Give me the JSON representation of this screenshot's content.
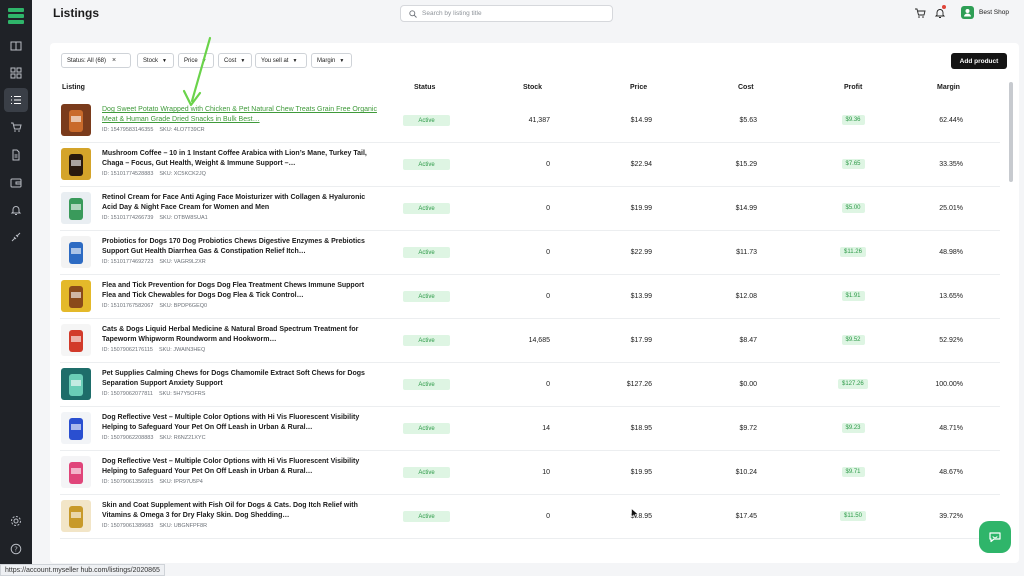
{
  "header": {
    "title": "Listings",
    "search_placeholder": "Search by listing title",
    "shop_name": "Best Shop"
  },
  "sidebar": {
    "items": [
      {
        "icon": "book-icon"
      },
      {
        "icon": "dashboard-icon"
      },
      {
        "icon": "list-icon",
        "active": true
      },
      {
        "icon": "cart-icon"
      },
      {
        "icon": "document-icon"
      },
      {
        "icon": "wallet-icon"
      },
      {
        "icon": "bell-icon"
      },
      {
        "icon": "plug-icon"
      },
      {
        "icon": "settings-icon"
      },
      {
        "icon": "help-icon"
      }
    ]
  },
  "filters": {
    "status": "Status: All (68)",
    "stock": "Stock",
    "price": "Price",
    "cost": "Cost",
    "you_sell_at": "You sell at",
    "margin": "Margin"
  },
  "actions": {
    "add_product": "Add product"
  },
  "table": {
    "headers": {
      "listing": "Listing",
      "status": "Status",
      "stock": "Stock",
      "price": "Price",
      "cost": "Cost",
      "profit": "Profit",
      "margin": "Margin"
    },
    "rows": [
      {
        "title": "Dog Sweet Potato Wrapped with Chicken & Pet Natural Chew Treats Grain Free Organic Meat & Human Grade Dried Snacks in Bulk Best…",
        "id": "ID: 15479583146355",
        "sku": "SKU: 4LO7T39CR",
        "status": "Active",
        "stock": "41,387",
        "price": "$14.99",
        "cost": "$5.63",
        "profit": "$9.36",
        "margin": "62.44%",
        "link": true
      },
      {
        "title": "Mushroom Coffee – 10 in 1 Instant Coffee Arabica with Lion’s Mane, Turkey Tail, Chaga – Focus, Gut Health, Weight & Immune Support –…",
        "id": "ID: 15101774528883",
        "sku": "SKU: XC5KCK2JQ",
        "status": "Active",
        "stock": "0",
        "price": "$22.94",
        "cost": "$15.29",
        "profit": "$7.65",
        "margin": "33.35%"
      },
      {
        "title": "Retinol Cream for Face Anti Aging Face Moisturizer with Collagen & Hyaluronic Acid Day & Night Face Cream for Women and Men",
        "id": "ID: 15101774266739",
        "sku": "SKU: OTBW8SUA1",
        "status": "Active",
        "stock": "0",
        "price": "$19.99",
        "cost": "$14.99",
        "profit": "$5.00",
        "margin": "25.01%"
      },
      {
        "title": "Probiotics for Dogs 170 Dog Probiotics Chews Digestive Enzymes & Prebiotics Support Gut Health Diarrhea Gas & Constipation Relief Itch…",
        "id": "ID: 15101774692723",
        "sku": "SKU: VAGR9L2XR",
        "status": "Active",
        "stock": "0",
        "price": "$22.99",
        "cost": "$11.73",
        "profit": "$11.26",
        "margin": "48.98%"
      },
      {
        "title": "Flea and Tick Prevention for Dogs Dog Flea Treatment Chews Immune Support Flea and Tick Chewables for Dogs Dog Flea & Tick Control…",
        "id": "ID: 15101767582067",
        "sku": "SKU: BPDP6GEQ0",
        "status": "Active",
        "stock": "0",
        "price": "$13.99",
        "cost": "$12.08",
        "profit": "$1.91",
        "margin": "13.65%"
      },
      {
        "title": "Cats & Dogs Liquid Herbal Medicine & Natural Broad Spectrum Treatment for Tapeworm Whipworm Roundworm and Hookworm…",
        "id": "ID: 15079062176115",
        "sku": "SKU: JWAIN3HEQ",
        "status": "Active",
        "stock": "14,685",
        "price": "$17.99",
        "cost": "$8.47",
        "profit": "$9.52",
        "margin": "52.92%"
      },
      {
        "title": "Pet Supplies Calming Chews for Dogs Chamomile Extract Soft Chews for Dogs Separation Support Anxiety Support",
        "id": "ID: 15079062077811",
        "sku": "SKU: 5H7Y5OFRS",
        "status": "Active",
        "stock": "0",
        "price": "$127.26",
        "cost": "$0.00",
        "profit": "$127.26",
        "margin": "100.00%"
      },
      {
        "title": "Dog Reflective Vest – Multiple Color Options with Hi Vis Fluorescent Visibility Helping to Safeguard Your Pet On Off Leash in Urban & Rural…",
        "id": "ID: 15079062208883",
        "sku": "SKU: R6NZ21XYC",
        "status": "Active",
        "stock": "14",
        "price": "$18.95",
        "cost": "$9.72",
        "profit": "$9.23",
        "margin": "48.71%"
      },
      {
        "title": "Dog Reflective Vest – Multiple Color Options with Hi Vis Fluorescent Visibility Helping to Safeguard Your Pet On Off Leash in Urban & Rural…",
        "id": "ID: 15079061356915",
        "sku": "SKU: IPR97U5P4",
        "status": "Active",
        "stock": "10",
        "price": "$19.95",
        "cost": "$10.24",
        "profit": "$9.71",
        "margin": "48.67%"
      },
      {
        "title": "Skin and Coat Supplement with Fish Oil for Dogs & Cats. Dog Itch Relief with Vitamins & Omega 3 for Dry Flaky Skin. Dog Shedding…",
        "id": "ID: 15079061389683",
        "sku": "SKU: UBGNFPF8R",
        "status": "Active",
        "stock": "0",
        "price": "$18.95",
        "cost": "$17.45",
        "profit": "$11.50",
        "margin": "39.72%"
      }
    ]
  },
  "status_url": "https://account.myseller hub.com/listings/2020865",
  "colors": {
    "accent": "#2fb56a",
    "sidebar": "#1f2227",
    "active_badge_bg": "#def5e3",
    "active_badge_text": "#2d9a48",
    "annotation_arrow": "#6ad34a"
  }
}
